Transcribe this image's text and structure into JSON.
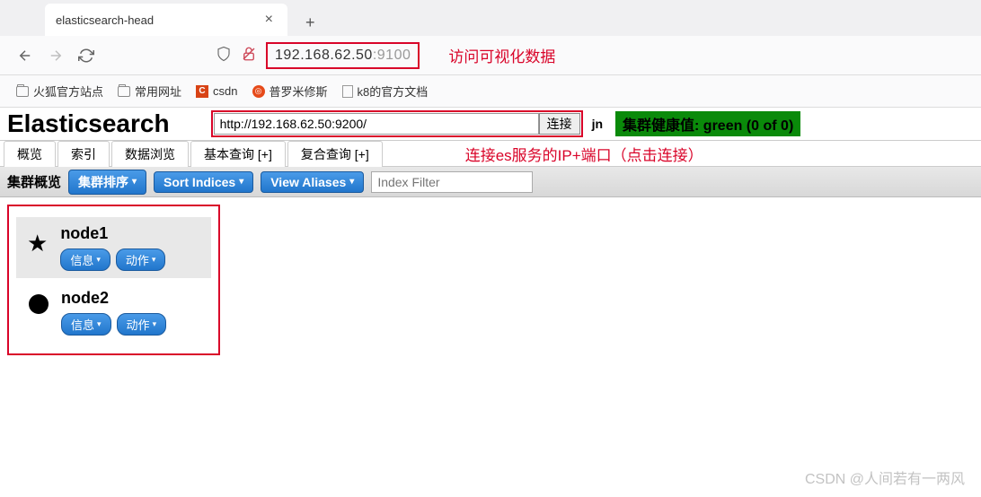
{
  "browser": {
    "tab_title": "elasticsearch-head",
    "url_host": "192.168.62.50",
    "url_port": ":9100",
    "annotation_access": "访问可视化数据",
    "bookmarks": [
      {
        "label": "火狐官方站点",
        "icon": "folder"
      },
      {
        "label": "常用网址",
        "icon": "folder"
      },
      {
        "label": "csdn",
        "icon": "c"
      },
      {
        "label": "普罗米修斯",
        "icon": "spiral"
      },
      {
        "label": "k8的官方文档",
        "icon": "doc"
      }
    ]
  },
  "es": {
    "logo": "Elasticsearch",
    "connect_url": "http://192.168.62.50:9200/",
    "connect_btn": "连接",
    "cluster_name": "jn",
    "health_text": "集群健康值: green (0 of 0)",
    "annotation_connect": "连接es服务的IP+端口（点击连接）",
    "tabs": {
      "overview": "概览",
      "indices": "索引",
      "browser": "数据浏览",
      "basic_query": "基本查询",
      "compound_query": "复合查询"
    },
    "toolbar": {
      "section_label": "集群概览",
      "sort_cluster": "集群排序",
      "sort_indices": "Sort Indices",
      "view_aliases": "View Aliases",
      "filter_placeholder": "Index Filter"
    },
    "nodes": [
      {
        "name": "node1",
        "info_btn": "信息",
        "action_btn": "动作",
        "master": true
      },
      {
        "name": "node2",
        "info_btn": "信息",
        "action_btn": "动作",
        "master": false
      }
    ]
  },
  "watermark": "CSDN @人间若有一两风"
}
